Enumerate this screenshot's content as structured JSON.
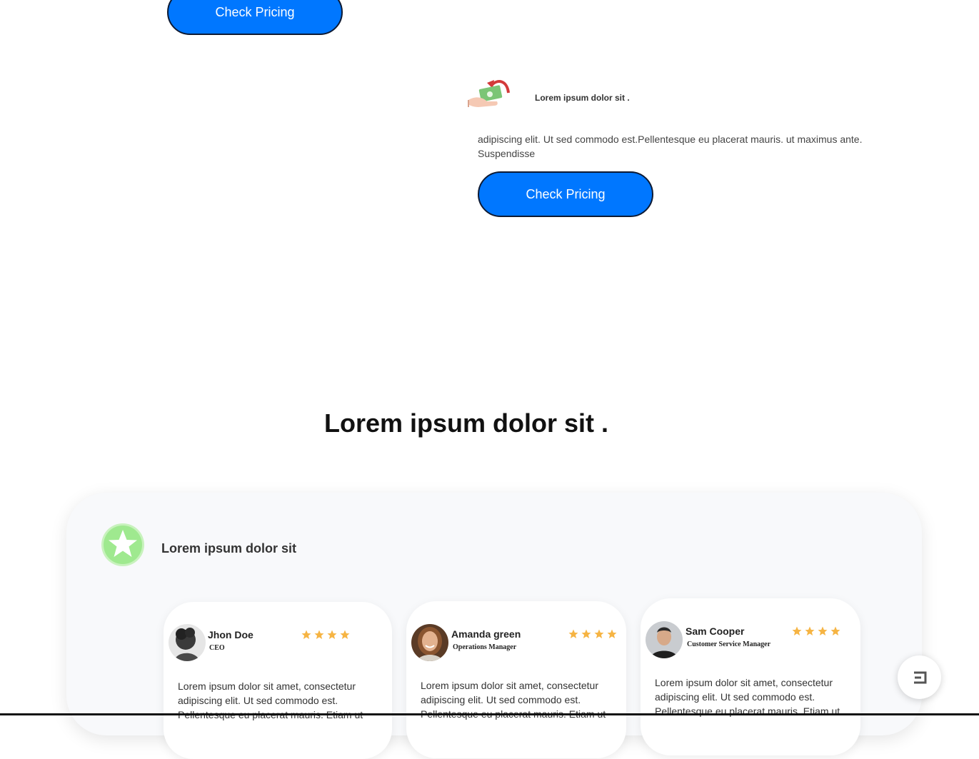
{
  "pricing": {
    "top_button_label": "Check Pricing",
    "feature_title": "Lorem ipsum dolor sit .",
    "feature_text": "adipiscing elit. Ut sed commodo est.Pellentesque eu placerat mauris. ut maximus ante. Suspendisse",
    "button_label": "Check Pricing",
    "icon": "hand-money-icon"
  },
  "testimonials": {
    "heading": "Lorem ipsum dolor sit .",
    "panel_title": "Lorem ipsum dolor sit",
    "badge_icon": "star-icon",
    "items": [
      {
        "name": "Jhon Doe",
        "role": "CEO",
        "stars": 4,
        "text": "Lorem ipsum dolor sit amet, consectetur adipiscing elit. Ut sed commodo est. Pellentesque eu placerat mauris. Etiam ut"
      },
      {
        "name": "Amanda green",
        "role": "Operations Manager",
        "stars": 4,
        "text": "Lorem ipsum dolor sit amet, consectetur adipiscing elit. Ut sed commodo est. Pellentesque eu placerat mauris. Etiam ut"
      },
      {
        "name": "Sam Cooper",
        "role": "Customer Service Manager",
        "stars": 4,
        "text": "Lorem ipsum dolor sit amet, consectetur adipiscing elit. Ut sed commodo est. Pellentesque eu placerat mauris. Etiam ut"
      }
    ]
  },
  "chat": {
    "icon": "chat-bubble-icon"
  },
  "colors": {
    "accent": "#0077ff",
    "star": "#f6b443",
    "badge": "#9fe98f"
  }
}
